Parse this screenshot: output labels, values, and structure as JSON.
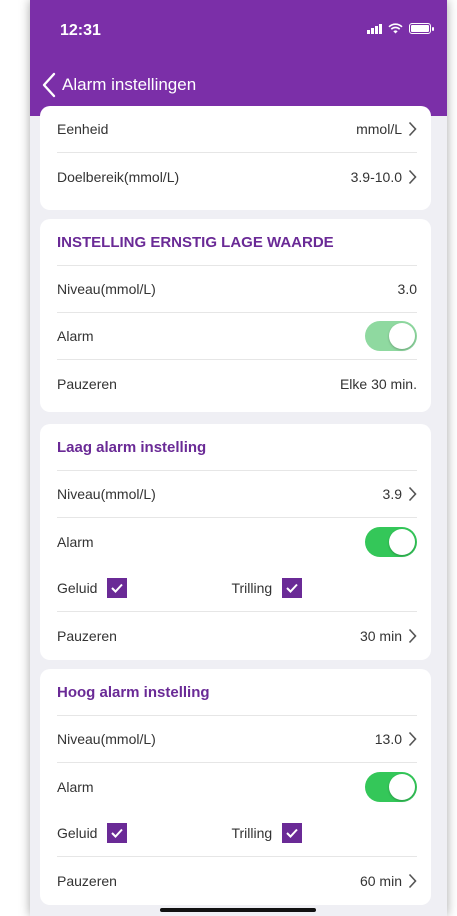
{
  "status": {
    "time": "12:31"
  },
  "nav": {
    "title": "Alarm instellingen"
  },
  "general": {
    "eenheid_label": "Eenheid",
    "eenheid_value": "mmol/L",
    "doelbereik_label": "Doelbereik(mmol/L)",
    "doelbereik_value": "3.9-10.0"
  },
  "critical_low": {
    "title": "INSTELLING ERNSTIG LAGE WAARDE",
    "niveau_label": "Niveau(mmol/L)",
    "niveau_value": "3.0",
    "alarm_label": "Alarm",
    "pauzeren_label": "Pauzeren",
    "pauzeren_value": "Elke 30 min."
  },
  "low": {
    "title": "Laag alarm instelling",
    "niveau_label": "Niveau(mmol/L)",
    "niveau_value": "3.9",
    "alarm_label": "Alarm",
    "geluid_label": "Geluid",
    "trilling_label": "Trilling",
    "pauzeren_label": "Pauzeren",
    "pauzeren_value": "30 min"
  },
  "high": {
    "title": "Hoog alarm instelling",
    "niveau_label": "Niveau(mmol/L)",
    "niveau_value": "13.0",
    "alarm_label": "Alarm",
    "geluid_label": "Geluid",
    "trilling_label": "Trilling",
    "pauzeren_label": "Pauzeren",
    "pauzeren_value": "60 min"
  },
  "colors": {
    "header": "#7b2fa8",
    "accent": "#6a2a96",
    "toggle_on": "#34c759",
    "toggle_disabled": "#8fd9a0"
  }
}
